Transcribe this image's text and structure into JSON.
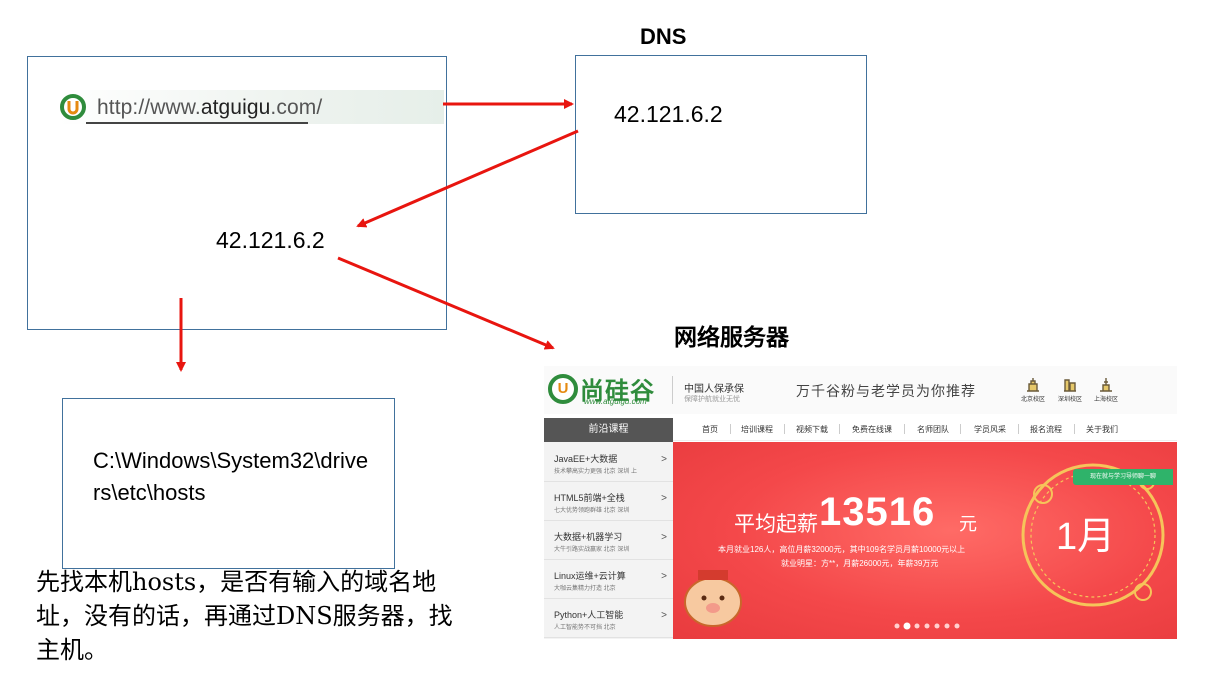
{
  "labels": {
    "dns_title": "DNS",
    "server_title": "网络服务器",
    "url_prefix": "http://www.",
    "url_domain": "atguigu",
    "url_suffix": ".com/",
    "dns_ip": "42.121.6.2",
    "client_ip": "42.121.6.2",
    "hosts_path": "C:\\Windows\\System32\\drivers\\etc\\hosts",
    "explanation": "先找本机hosts，是否有输入的域名地址，没有的话，再通过DNS服务器，找主机。"
  },
  "website": {
    "logo_text": "尚硅谷",
    "logo_url": "www.atguigu.com",
    "insurance_title": "中国人保承保",
    "insurance_sub": "保障护航就业无忧",
    "slogan": "万千谷粉与老学员为你推荐",
    "campuses": [
      "北京校区",
      "深圳校区",
      "上海校区"
    ],
    "side_header": "前沿课程",
    "nav": [
      "首页",
      "培训课程",
      "视频下载",
      "免费在线课",
      "名师团队",
      "学员风采",
      "报名流程",
      "关于我们"
    ],
    "side_items": [
      {
        "title": "JavaEE+大数据",
        "sub": "技术攀高实力更强  北京  深圳  上"
      },
      {
        "title": "HTML5前端+全栈",
        "sub": "七大优势领跑群雄  北京  深圳"
      },
      {
        "title": "大数据+机器学习",
        "sub": "大牛引路实战赢家  北京  深圳"
      },
      {
        "title": "Linux运维+云计算",
        "sub": "大咖云集精力打造  北京"
      },
      {
        "title": "Python+人工智能",
        "sub": "人工智能势不可挡  北京"
      }
    ],
    "banner": {
      "avg_label": "平均起薪",
      "salary": "13516",
      "unit": "元",
      "line1": "本月就业126人，高位月薪32000元，其中109名学员月薪10000元以上",
      "line2": "就业明星：方**，月薪26000元，年薪39万元",
      "tag": "现在就与学习导师聊一聊",
      "month": "1月"
    }
  },
  "colors": {
    "box_border": "#41719c",
    "arrow": "#e8150f",
    "logo_green": "#2f8c3c",
    "banner_red": "#f4484a"
  }
}
